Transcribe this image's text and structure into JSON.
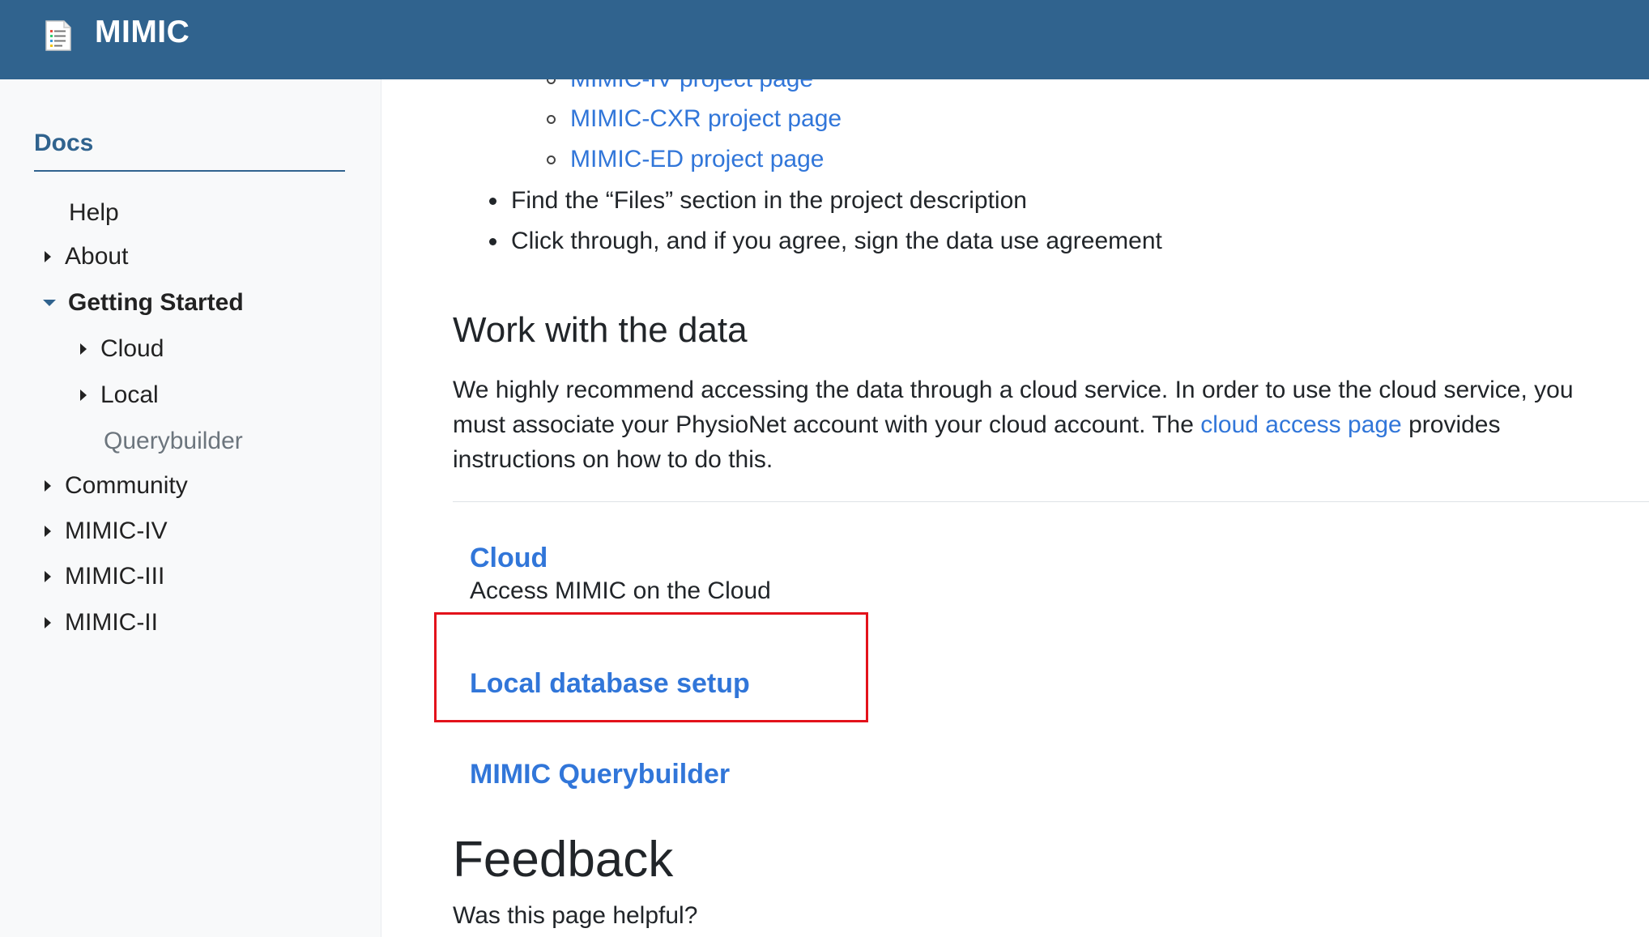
{
  "header": {
    "brand": "MIMIC",
    "logo_icon": "document-list-icon",
    "background": "#30638e"
  },
  "sidebar": {
    "title": "Docs",
    "items": [
      {
        "label": "Help",
        "caret": "none",
        "level": 0
      },
      {
        "label": "About",
        "caret": "right",
        "level": 0
      },
      {
        "label": "Getting Started",
        "caret": "down",
        "level": 0,
        "active": true
      },
      {
        "label": "Cloud",
        "caret": "right",
        "level": 1
      },
      {
        "label": "Local",
        "caret": "right",
        "level": 1
      },
      {
        "label": "Querybuilder",
        "caret": "none",
        "level": 1,
        "muted": true
      },
      {
        "label": "Community",
        "caret": "right",
        "level": 0
      },
      {
        "label": "MIMIC-IV",
        "caret": "right",
        "level": 0
      },
      {
        "label": "MIMIC-III",
        "caret": "right",
        "level": 0
      },
      {
        "label": "MIMIC-II",
        "caret": "right",
        "level": 0
      }
    ]
  },
  "main": {
    "sub_links": [
      "MIMIC-IV project page",
      "MIMIC-CXR project page",
      "MIMIC-ED project page"
    ],
    "steps": [
      "Find the “Files” section in the project description",
      "Click through, and if you agree, sign the data use agreement"
    ],
    "section_heading": "Work with the data",
    "paragraph_before_link": "We highly recommend accessing the data through a cloud service. In order to use the cloud service, you must associate your PhysioNet account with your cloud account. The ",
    "paragraph_link": "cloud access page",
    "paragraph_after_link": " provides instructions on how to do this.",
    "cards": [
      {
        "title": "Cloud",
        "description": "Access MIMIC on the Cloud"
      },
      {
        "title": "Local database setup",
        "description": ""
      },
      {
        "title": "MIMIC Querybuilder",
        "description": ""
      }
    ],
    "feedback_heading": "Feedback",
    "feedback_question": "Was this page helpful?"
  },
  "colors": {
    "link": "#3176d9",
    "highlight_border": "#e3121b",
    "sidebar_accent": "#30638e"
  }
}
